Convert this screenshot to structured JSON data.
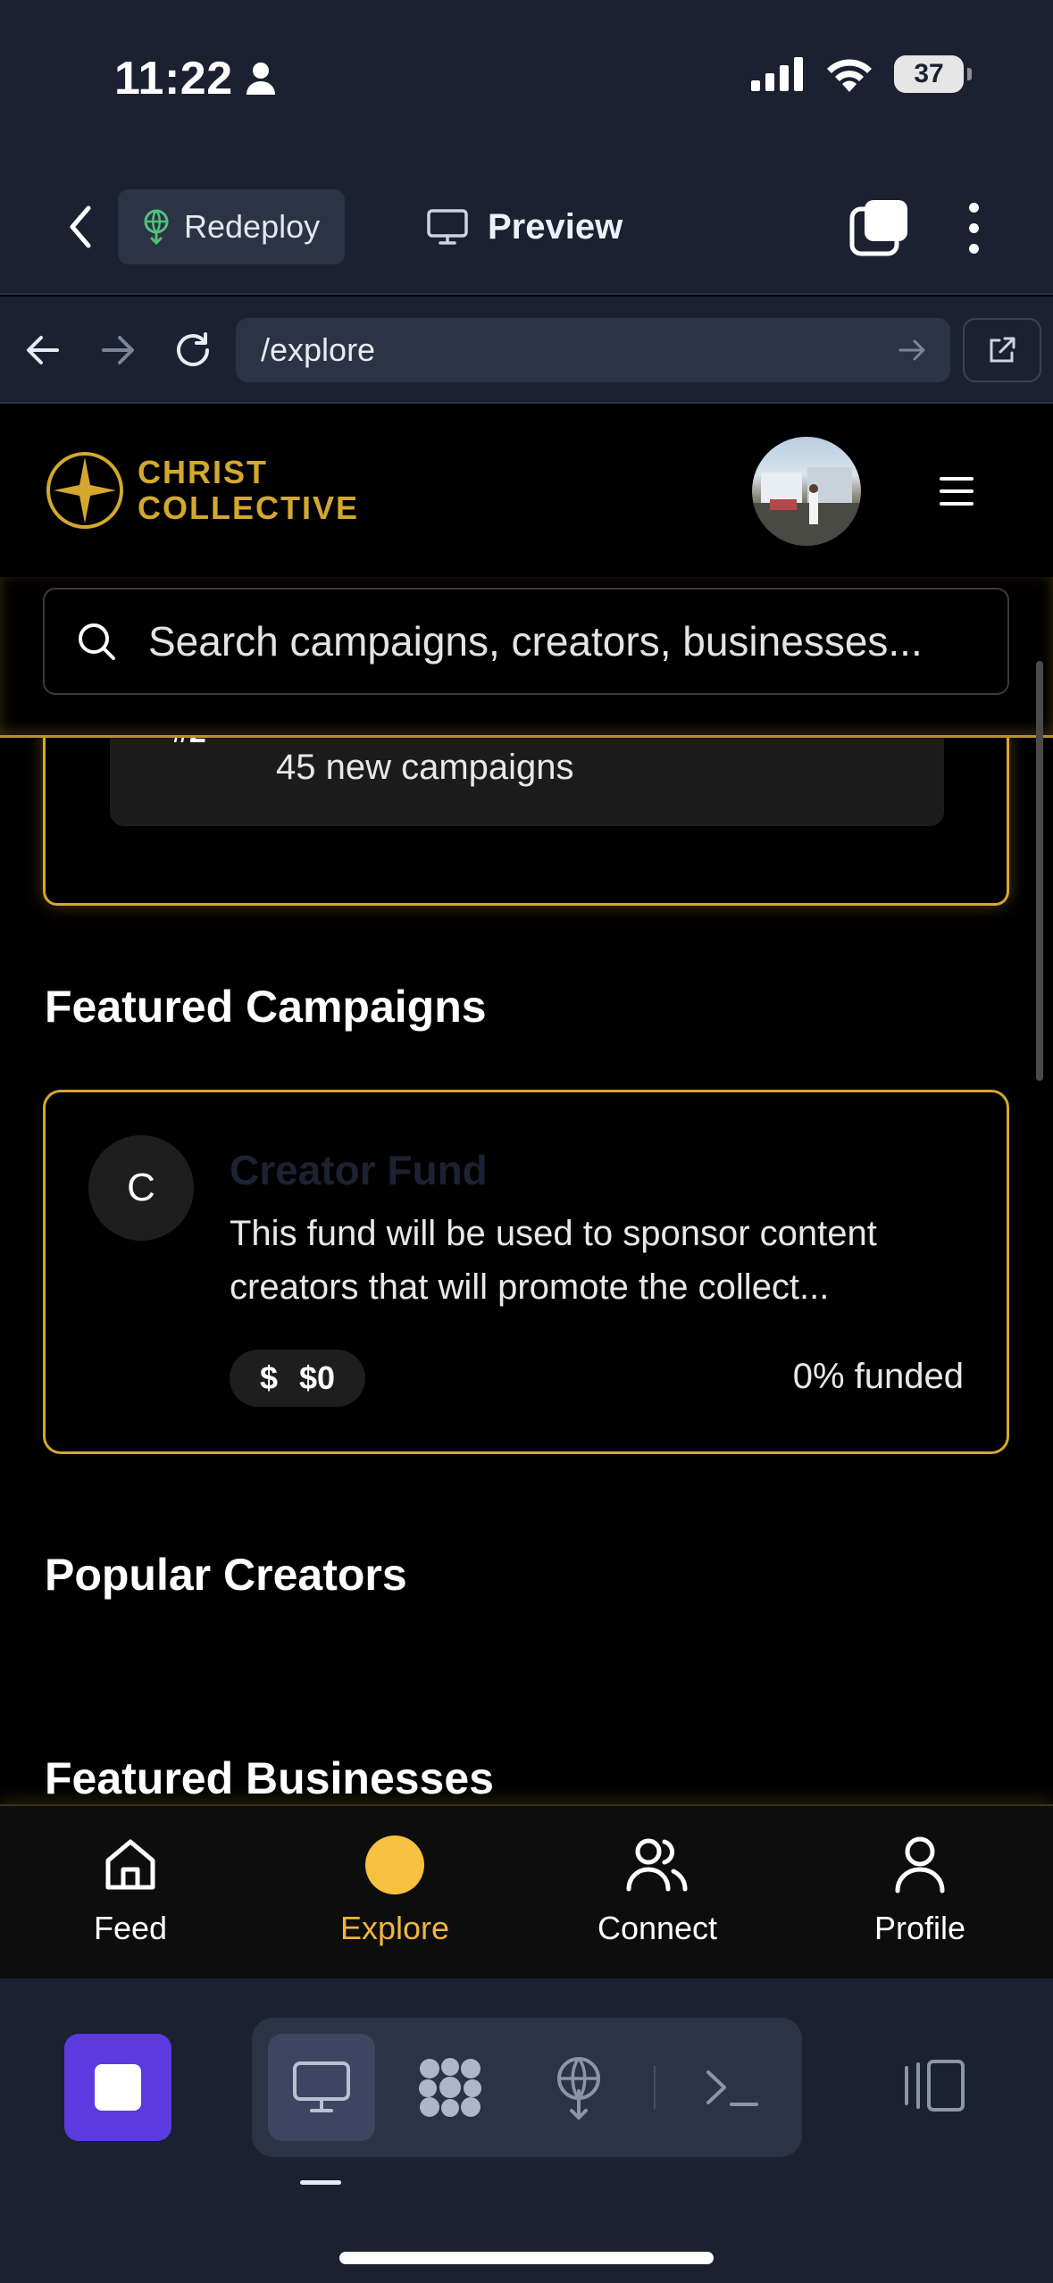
{
  "status_bar": {
    "time": "11:22",
    "battery": "37"
  },
  "replit_topbar": {
    "redeploy_label": "Redeploy",
    "preview_label": "Preview"
  },
  "url_bar": {
    "path": "/explore"
  },
  "app_header": {
    "logo_line1": "CHRIST",
    "logo_line2": "COLLECTIVE",
    "accent_color": "#d4a82e"
  },
  "search": {
    "placeholder": "Search campaigns, creators, businesses..."
  },
  "trending": {
    "rank": "#2",
    "subtitle": "45 new campaigns"
  },
  "sections": {
    "featured_campaigns": "Featured Campaigns",
    "popular_creators": "Popular Creators",
    "featured_businesses": "Featured Businesses"
  },
  "campaign": {
    "avatar_letter": "C",
    "title": "Creator Fund",
    "description": "This fund will be used to sponsor content creators that will promote the collect...",
    "amount_symbol": "$",
    "amount": "$0",
    "funded": "0% funded"
  },
  "bottom_nav": {
    "items": [
      {
        "label": "Feed",
        "icon": "home-icon"
      },
      {
        "label": "Explore",
        "icon": "explore-dot-icon"
      },
      {
        "label": "Connect",
        "icon": "users-icon"
      },
      {
        "label": "Profile",
        "icon": "user-icon"
      }
    ],
    "active_color": "#f0b53a"
  },
  "replit_toolbar": {
    "stop_color": "#5b3be0"
  }
}
